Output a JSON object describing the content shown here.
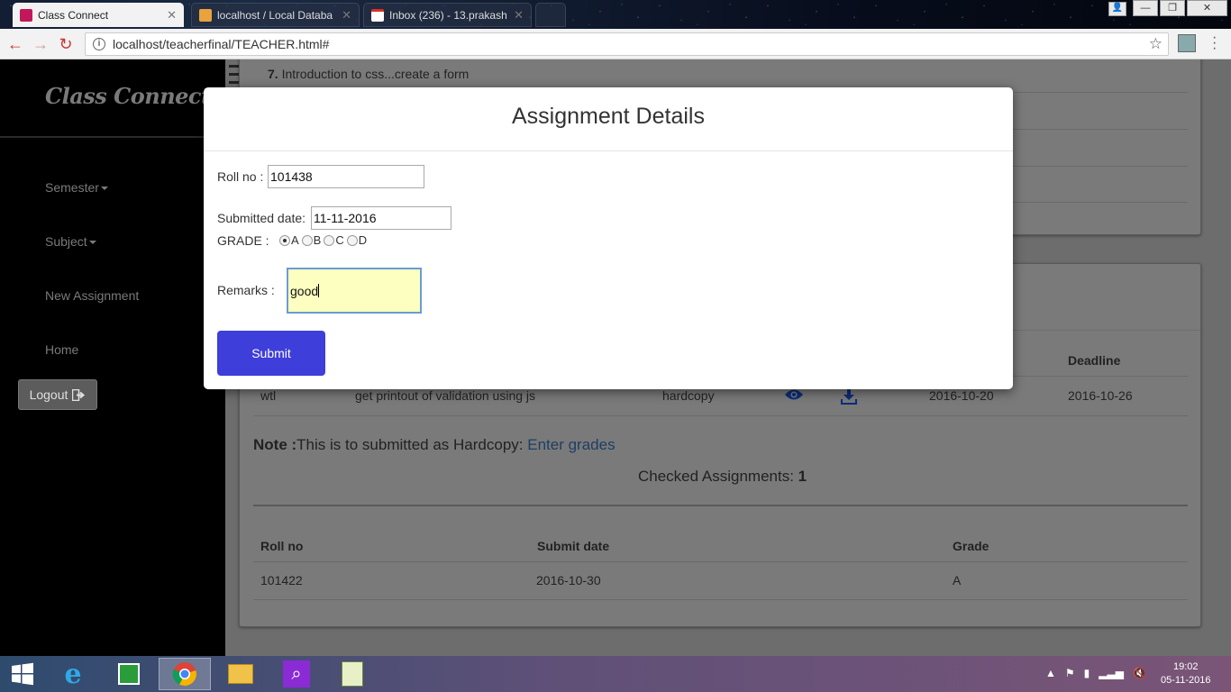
{
  "browser": {
    "tabs": [
      {
        "title": "Class Connect",
        "active": true
      },
      {
        "title": "localhost / Local Databa",
        "active": false
      },
      {
        "title": "Inbox (236) - 13.prakash",
        "active": false
      }
    ],
    "url": "localhost/teacherfinal/TEACHER.html#"
  },
  "sidebar": {
    "brand": "Class Connect",
    "items": [
      {
        "label": "Semester",
        "dropdown": true
      },
      {
        "label": "Subject",
        "dropdown": true
      },
      {
        "label": "New Assignment"
      },
      {
        "label": "Home"
      }
    ],
    "logout_label": "Logout"
  },
  "background_page": {
    "list_item_number": "7.",
    "list_item_text": "Introduction to css...create a form",
    "assignments_table": {
      "visible_headers": {
        "deadline": "Deadline"
      },
      "row": {
        "subject": "wtl",
        "description": "get printout of validation using js",
        "type": "hardcopy",
        "date": "2016-10-20",
        "deadline": "2016-10-26"
      }
    },
    "note_label": "Note :",
    "note_text": "This is to submitted as Hardcopy:",
    "note_link": "Enter grades",
    "checked_label": "Checked Assignments:",
    "checked_count": "1",
    "checked_table": {
      "headers": [
        "Roll no",
        "Submit date",
        "Grade"
      ],
      "rows": [
        [
          "101422",
          "2016-10-30",
          "A"
        ]
      ]
    }
  },
  "modal": {
    "title": "Assignment Details",
    "roll_label": "Roll no :",
    "roll_value": "101438",
    "date_label": "Submitted date:",
    "date_value": "11-11-2016",
    "grade_label": "GRADE :",
    "grades": [
      "A",
      "B",
      "C",
      "D"
    ],
    "selected_grade": "A",
    "remarks_label": "Remarks :",
    "remarks_value": "good",
    "submit_label": "Submit"
  },
  "taskbar": {
    "time": "19:02",
    "date": "05-11-2016"
  },
  "colors": {
    "submit_button": "#3e3edb",
    "remarks_bg": "#fcffbf",
    "link": "#1f3e66"
  }
}
